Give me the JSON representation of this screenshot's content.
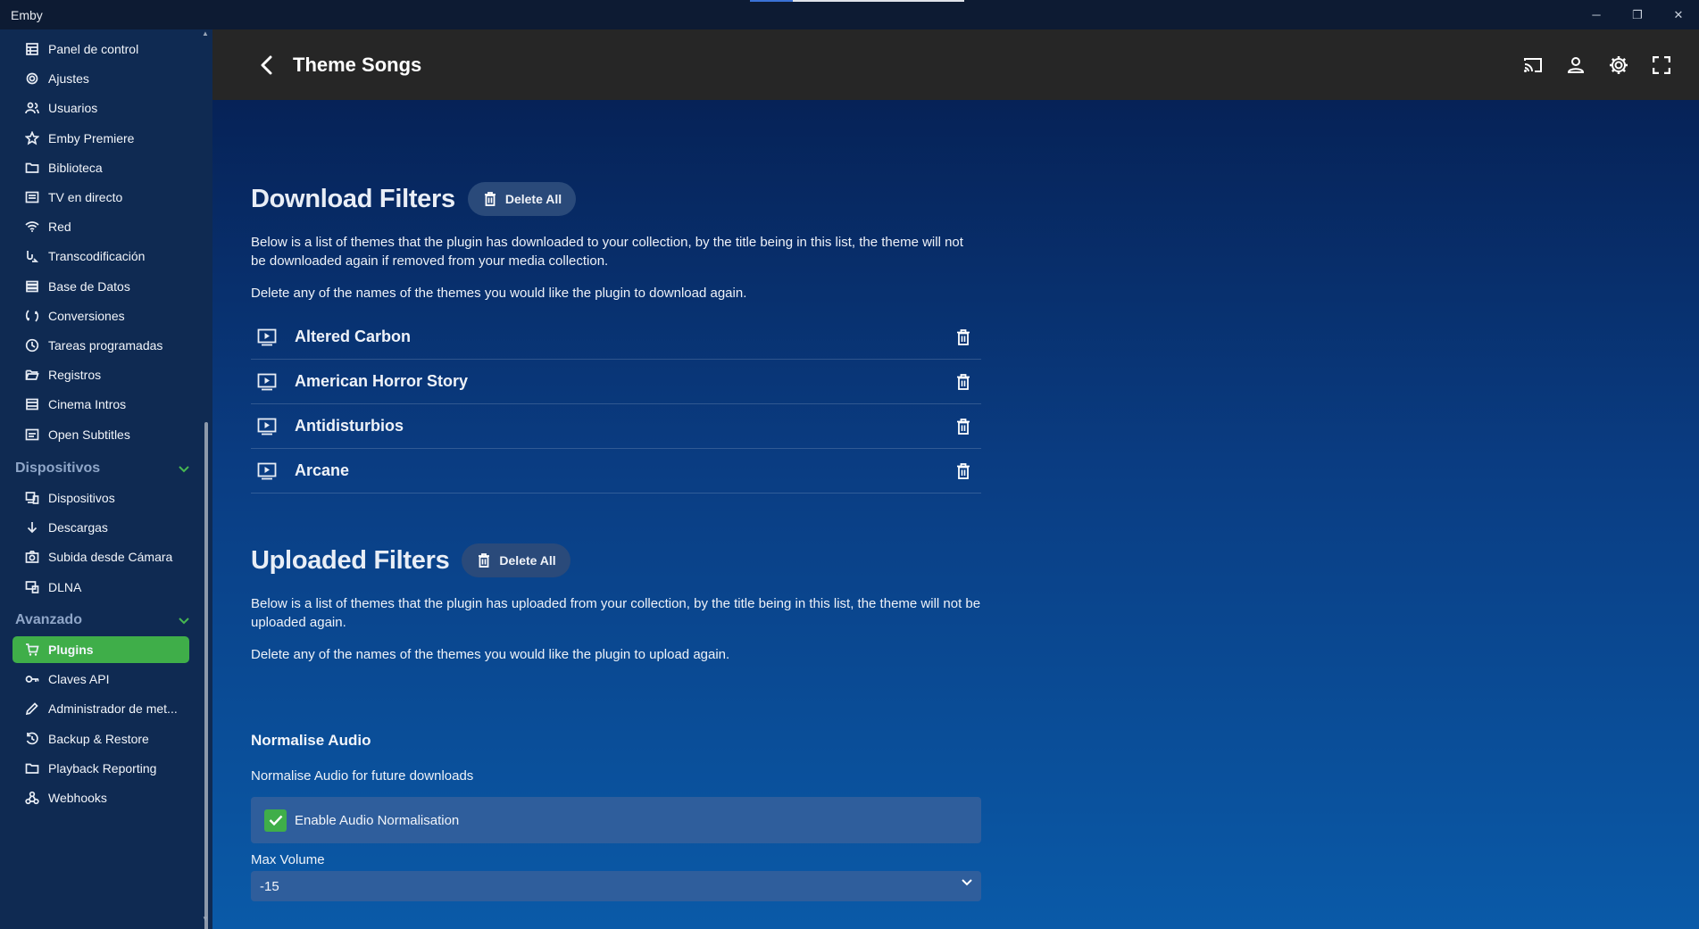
{
  "window": {
    "title": "Emby",
    "controls": {
      "minimize": "─",
      "restore": "❐",
      "close": "✕"
    }
  },
  "sidebar": {
    "items_top": [
      {
        "label": "Panel de control",
        "icon": "dashboard-icon"
      },
      {
        "label": "Ajustes",
        "icon": "gear-icon"
      },
      {
        "label": "Usuarios",
        "icon": "users-icon"
      },
      {
        "label": "Emby Premiere",
        "icon": "star-icon"
      },
      {
        "label": "Biblioteca",
        "icon": "folder-icon"
      },
      {
        "label": "TV en directo",
        "icon": "tv-guide-icon"
      },
      {
        "label": "Red",
        "icon": "wifi-icon"
      },
      {
        "label": "Transcodificación",
        "icon": "transcode-icon"
      },
      {
        "label": "Base de Datos",
        "icon": "database-icon"
      },
      {
        "label": "Conversiones",
        "icon": "convert-icon"
      },
      {
        "label": "Tareas programadas",
        "icon": "clock-icon"
      },
      {
        "label": "Registros",
        "icon": "folder-open-icon"
      },
      {
        "label": "Cinema Intros",
        "icon": "film-icon"
      },
      {
        "label": "Open Subtitles",
        "icon": "subtitles-icon"
      }
    ],
    "section_devices": "Dispositivos",
    "items_devices": [
      {
        "label": "Dispositivos",
        "icon": "devices-icon"
      },
      {
        "label": "Descargas",
        "icon": "download-arrow-icon"
      },
      {
        "label": "Subida desde Cámara",
        "icon": "camera-icon"
      },
      {
        "label": "DLNA",
        "icon": "dlna-icon"
      }
    ],
    "section_advanced": "Avanzado",
    "items_advanced": [
      {
        "label": "Plugins",
        "icon": "cart-icon",
        "active": true
      },
      {
        "label": "Claves API",
        "icon": "key-icon"
      },
      {
        "label": "Administrador de met...",
        "icon": "pencil-icon"
      },
      {
        "label": "Backup & Restore",
        "icon": "restore-icon"
      },
      {
        "label": "Playback Reporting",
        "icon": "folder-icon"
      },
      {
        "label": "Webhooks",
        "icon": "webhook-icon"
      }
    ]
  },
  "header": {
    "title": "Theme Songs"
  },
  "download_filters": {
    "title": "Download Filters",
    "delete_all": "Delete All",
    "description": "Below is a list of themes that the plugin has downloaded to your collection, by the title being in this list, the theme will not be downloaded again if removed from your media collection.",
    "instruction": "Delete any of the names of the themes you would like the plugin to download again.",
    "items": [
      "Altered Carbon",
      "American Horror Story",
      "Antidisturbios",
      "Arcane"
    ]
  },
  "uploaded_filters": {
    "title": "Uploaded Filters",
    "delete_all": "Delete All",
    "description": "Below is a list of themes that the plugin has uploaded from your collection, by the title being in this list, the theme will not be uploaded again.",
    "instruction": "Delete any of the names of the themes you would like the plugin to upload again."
  },
  "normalise_audio": {
    "title": "Normalise Audio",
    "description": "Normalise Audio for future downloads",
    "checkbox_label": "Enable Audio Normalisation",
    "checked": true,
    "max_volume_label": "Max Volume",
    "max_volume_value": "-15"
  },
  "colors": {
    "accent_green": "#3fae49",
    "header_bg": "#262626",
    "sidebar_bg": "#0f2a52"
  }
}
